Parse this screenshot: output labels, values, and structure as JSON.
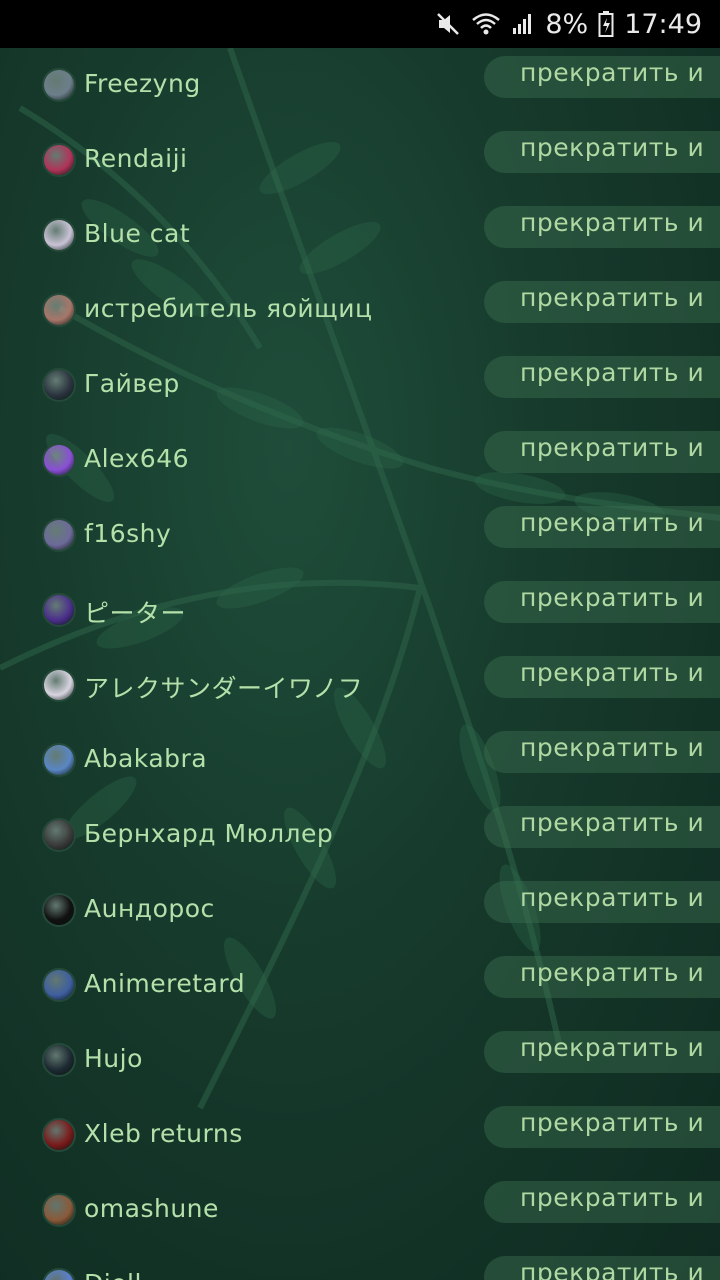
{
  "status_bar": {
    "battery": "8%",
    "time": "17:49",
    "icons": [
      "mute-icon",
      "wifi-icon",
      "signal-icon",
      "battery-icon"
    ]
  },
  "list": {
    "action_label": "прекратить и",
    "users": [
      {
        "name": "Freezyng",
        "avatar_color": "#6d7f8c"
      },
      {
        "name": "Rendaiji",
        "avatar_color": "#b0345a"
      },
      {
        "name": "Blue cat",
        "avatar_color": "#c9c3d6"
      },
      {
        "name": "истребитель яойщиц",
        "avatar_color": "#a8766a"
      },
      {
        "name": "Гайвер",
        "avatar_color": "#2c3540"
      },
      {
        "name": "Alex646",
        "avatar_color": "#8a4fd6"
      },
      {
        "name": "f16shy",
        "avatar_color": "#6d6a9a"
      },
      {
        "name": "ピーター",
        "avatar_color": "#4b2f8c"
      },
      {
        "name": "アレクサンダーイワノフ",
        "avatar_color": "#d8d4e0"
      },
      {
        "name": "Abakabra",
        "avatar_color": "#5a86c4"
      },
      {
        "name": "Бернхард Мюллер",
        "avatar_color": "#3b3b3b"
      },
      {
        "name": "Аuндорос",
        "avatar_color": "#111111"
      },
      {
        "name": "Animeretard",
        "avatar_color": "#3f5fa0"
      },
      {
        "name": "Hujo",
        "avatar_color": "#1e2a33"
      },
      {
        "name": "Xleb returns",
        "avatar_color": "#7a1b1b"
      },
      {
        "name": "omashune",
        "avatar_color": "#8a5a3a"
      },
      {
        "name": "Dioll",
        "avatar_color": "#5a7fd0"
      }
    ]
  }
}
